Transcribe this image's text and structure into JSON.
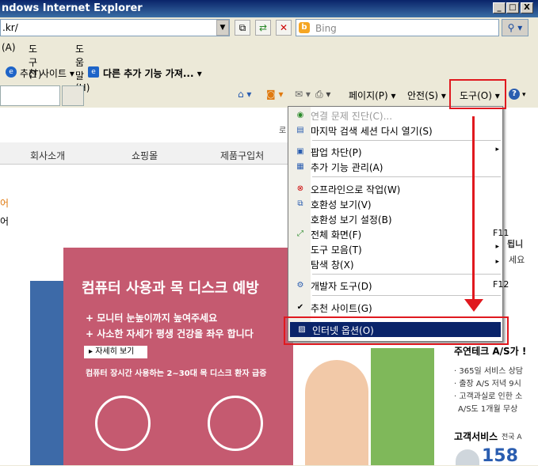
{
  "window": {
    "title": "ndows Internet Explorer",
    "min": "_",
    "max": "□",
    "close": "X"
  },
  "address": {
    "value": ".kr/"
  },
  "search": {
    "placeholder": "Bing"
  },
  "menubar": [
    "(A)",
    "도구(T)",
    "도움말(H)"
  ],
  "favorites": {
    "suggested": "추천 사이트 ▾",
    "addons": "다른 추가 기능 가져...  ▾"
  },
  "commandbar": {
    "page": "페이지(P) ▾",
    "safety": "안전(S) ▾",
    "tools": "도구(O) ▾",
    "help": "?"
  },
  "page": {
    "nav": [
      "회사소개",
      "쇼핑몰",
      "제품구입처"
    ],
    "banner_title": "컴퓨터 사용과 목 디스크 예방",
    "banner_line1": "+ 모니터 눈높이까지 높여주세요",
    "banner_line2": "+ 사소한 자세가 평생 건강을 좌우 합니다",
    "more": "▸ 자세히 보기",
    "banner_note": "컴퓨터 장시간 사용하는 2~30대 목 디스크 환자 급증",
    "right_title": "주연테크 A/S가 !",
    "right_items": [
      "· 365일 서비스 상담",
      "· 출장 A/S 저녁 9시",
      "· 고객과실로 인한 소",
      "A/S도 1개월 무상"
    ],
    "cs_label": "고객서비스",
    "cs_sub": "전국 A",
    "cs_number": "158",
    "frag1": "로",
    "frag2": "됩니",
    "frag3": "세요",
    "frag4": "어",
    "frag5": "어"
  },
  "tools_menu": {
    "items": [
      {
        "label": "연결 문제 진단(C)...",
        "disabled": true,
        "icon": "diagnose-icon"
      },
      {
        "label": "마지막 검색 세션 다시 열기(S)",
        "icon": "reopen-icon"
      },
      {
        "label": "팝업 차단(P)",
        "arrow": "▸",
        "icon": "popup-icon"
      },
      {
        "label": "추가 기능 관리(A)",
        "icon": "addons-icon"
      },
      {
        "label": "오프라인으로 작업(W)",
        "icon": "offline-icon"
      },
      {
        "label": "호환성 보기(V)",
        "icon": "compat-icon"
      },
      {
        "label": "호환성 보기 설정(B)"
      },
      {
        "label": "전체 화면(F)",
        "shortcut": "F11",
        "icon": "fullscreen-icon"
      },
      {
        "label": "도구 모음(T)",
        "arrow": "▸"
      },
      {
        "label": "탐색 창(X)",
        "arrow": "▸"
      },
      {
        "label": "개발자 도구(D)",
        "shortcut": "F12",
        "icon": "devtools-icon"
      },
      {
        "label": "추천 사이트(G)",
        "icon": "check-icon"
      },
      {
        "label": "인터넷 옵션(O)",
        "icon": "options-icon"
      }
    ]
  },
  "colors": {
    "highlight": "#0a246a",
    "annotation": "#e0191f",
    "banner": "#c55a70"
  }
}
